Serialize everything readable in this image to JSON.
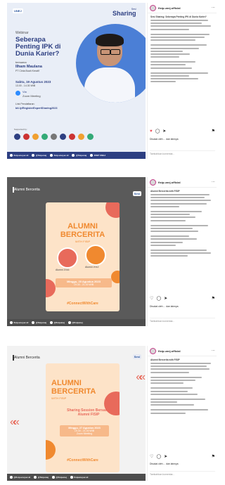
{
  "posts": [
    {
      "username": "fisip.unej.official",
      "poster": {
        "logo1": "UNEJ",
        "brand_small": "Sesi",
        "brand_big": "Sharing",
        "kicker": "Webinar",
        "title": "Seberapa Penting IPK di Dunia Karier?",
        "bersama": "bersama",
        "speaker": "Ilham Maulana",
        "speaker_role": "PT Cinta Buah Kreatif",
        "date": "Sabtu, 19 Agustus 2023",
        "time": "13.00 - 14.30 WIB",
        "via": "Via",
        "platform": "Zoom Meeting",
        "link_label": "Link Pendaftaran:",
        "link": "bit.ly/RegisterExpertSharing2023",
        "supported": "Supported by:",
        "footer": [
          "fisip.unej.ac.id",
          "@fisipunej",
          "fisip.unej.ac.id",
          "@fisipunej",
          "FISIP UNEJ"
        ]
      },
      "caption_title": "Sesi Sharing: Seberapa Penting IPK di Dunia Karier?",
      "likes": "Disukai oleh ... dan lainnya",
      "add_comment": "Tambahkan komentar..."
    },
    {
      "username": "fisip.unej.official",
      "poster": {
        "tag": "Alumni Bercerita",
        "logo": "Sesi",
        "title1": "ALUMNI",
        "title2": "BERCERITA",
        "sub": "WITH FISIP",
        "person1": "Alumni 2016",
        "person2": "Alumni 2012",
        "session": "Minggu, 20 Agustus 2023",
        "session2": "19.30 - 21.00 WIB",
        "hashtag": "#ConnectWithCare",
        "footer": [
          "fisip.unej.ac.id",
          "@fisipunej",
          "@fisipunej",
          "@fisipunej"
        ]
      },
      "caption_title": "Alumni Bercerita with FISIP",
      "likes": "Disukai oleh ... dan lainnya",
      "add_comment": "Tambahkan komentar..."
    },
    {
      "username": "fisip.unej.official",
      "poster": {
        "tag": "Alumni Bercerita",
        "logo": "Sesi",
        "title1": "ALUMNI",
        "title2": "BERCERITA",
        "sub": "WITH FISIP",
        "session_title": "Sharing Session Bersama Alumni FISIP",
        "session": "Minggu, 27 Agustus 2023",
        "session2": "19.30 - 21.00 WIB",
        "platform": "Zoom Meeting",
        "hashtag": "#ConnectWithCare",
        "footer": [
          "@fisip.unej.ac.id",
          "@fisipunej",
          "@fisipunej",
          "fisipunej.ac.id"
        ]
      },
      "caption_title": "Alumni Bercerita with FISIP",
      "likes": "Disukai oleh ... dan lainnya",
      "add_comment": "Tambahkan komentar..."
    }
  ],
  "icons": [
    "heart-icon",
    "comment-icon",
    "share-icon",
    "bookmark-icon",
    "more-icon"
  ],
  "colors": {
    "navy": "#2d3f82",
    "blue_circle": "#4b7fd6",
    "orange": "#f0892f",
    "peach": "#fde3c8",
    "gray_bg": "#4d4d4d",
    "pink": "#e86a5b"
  }
}
